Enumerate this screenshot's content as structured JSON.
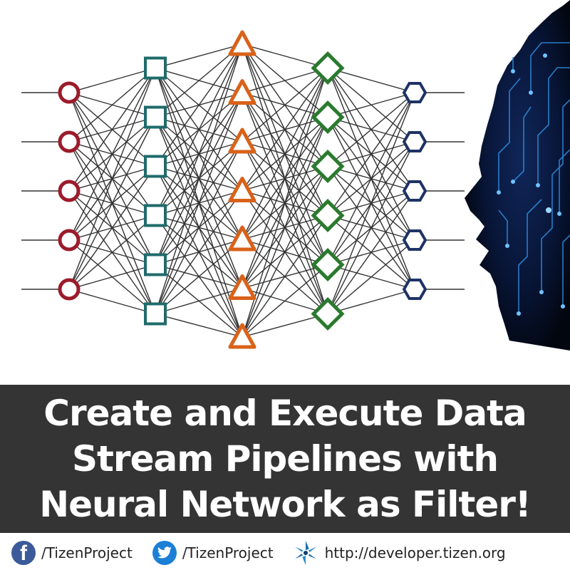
{
  "headline": {
    "line1": "Create and Execute Data",
    "line2": "Stream Pipelines with",
    "line3": "Neural Network as Filter!"
  },
  "footer": {
    "facebook_handle": "/TizenProject",
    "twitter_handle": "/TizenProject",
    "website": "http://developer.tizen.org"
  },
  "network": {
    "layers": [
      {
        "shape": "circle",
        "count": 5,
        "color": "#9b1b2a"
      },
      {
        "shape": "square",
        "count": 6,
        "color": "#1f6b6b"
      },
      {
        "shape": "triangle",
        "count": 7,
        "color": "#d9621a"
      },
      {
        "shape": "diamond",
        "count": 6,
        "color": "#2a7a2e"
      },
      {
        "shape": "hexagon",
        "count": 5,
        "color": "#1e3366"
      }
    ],
    "edge_color": "#333333"
  },
  "colors": {
    "title_band": "#343434",
    "title_text": "#ffffff",
    "facebook": "#3b5a9a",
    "twitter": "#1b7fd6",
    "head_dark": "#050b1e",
    "circuit": "#2f8fe0"
  },
  "icons": [
    "facebook-icon",
    "twitter-icon",
    "tizen-icon"
  ]
}
